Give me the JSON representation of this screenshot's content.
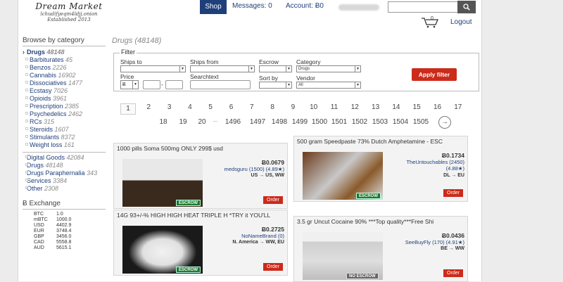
{
  "header": {
    "logo_name": "Dream Market",
    "logo_onion": "lchudifyeqm4ldjj.onion",
    "logo_established": "Established 2013",
    "shop_label": "Shop",
    "messages": "Messages: 0",
    "account": "Account: Ƀ0",
    "search_button": "search-icon",
    "cart_count": "0",
    "logout": "Logout"
  },
  "sidebar": {
    "title": "Browse by category",
    "categories": [
      {
        "label": "Drugs",
        "count": "48148"
      },
      {
        "label": "Barbiturates",
        "count": "45"
      },
      {
        "label": "Benzos",
        "count": "2226"
      },
      {
        "label": "Cannabis",
        "count": "16902"
      },
      {
        "label": "Dissociatives",
        "count": "1477"
      },
      {
        "label": "Ecstasy",
        "count": "7026"
      },
      {
        "label": "Opioids",
        "count": "3961"
      },
      {
        "label": "Prescription",
        "count": "2385"
      },
      {
        "label": "Psychedelics",
        "count": "2462"
      },
      {
        "label": "RCs",
        "count": "315"
      },
      {
        "label": "Steroids",
        "count": "1607"
      },
      {
        "label": "Stimulants",
        "count": "8372"
      },
      {
        "label": "Weight loss",
        "count": "161"
      }
    ],
    "top_categories": [
      {
        "label": "Digital Goods",
        "count": "42084"
      },
      {
        "label": "Drugs",
        "count": "48148"
      },
      {
        "label": "Drugs Paraphernalia",
        "count": "343"
      },
      {
        "label": "Services",
        "count": "3384"
      },
      {
        "label": "Other",
        "count": "2308"
      }
    ],
    "exchange_title": "Ƀ Exchange",
    "exchange": [
      {
        "cur": "BTC",
        "val": "1.0"
      },
      {
        "cur": "mBTC",
        "val": "1000.0"
      },
      {
        "cur": "USD",
        "val": "4402.9"
      },
      {
        "cur": "EUR",
        "val": "3748.4"
      },
      {
        "cur": "GBP",
        "val": "3456.0"
      },
      {
        "cur": "CAD",
        "val": "5558.8"
      },
      {
        "cur": "AUD",
        "val": "5615.1"
      }
    ]
  },
  "main": {
    "title": "Drugs (48148)",
    "filter": {
      "legend": "Filter",
      "ships_to": "Ships to",
      "ships_from": "Ships from",
      "escrow": "Escrow",
      "category": "Category",
      "category_value": "Drugs",
      "price": "Price",
      "price_currency": "Ƀ",
      "price_dash": "-",
      "searchtext": "Searchtext",
      "sort_by": "Sort by",
      "vendor": "Vendor",
      "vendor_value": "All",
      "apply": "Apply filter"
    },
    "pagination_row1": [
      "1",
      "2",
      "3",
      "4",
      "5",
      "6",
      "7",
      "8",
      "9",
      "10",
      "11",
      "12",
      "13",
      "14",
      "15",
      "16",
      "17"
    ],
    "pagination_row2": [
      "18",
      "19",
      "20",
      "...",
      "1496",
      "1497",
      "1498",
      "1499",
      "1500",
      "1501",
      "1502",
      "1503",
      "1504",
      "1505"
    ],
    "next_icon": "arrow-right-icon"
  },
  "listings": [
    {
      "title": "1000 pills Soma 500mg ONLY 299$ usd",
      "price": "Ƀ0.0679",
      "vendor": "medsguru (1500) (4.89★)",
      "ship": "US → US, WW",
      "escrow": "ESCROW",
      "order": "Order"
    },
    {
      "title": "500 gram Speedpaste 73% Dutch Amphetamine - ESC",
      "price": "Ƀ0.1734",
      "vendor": "TheUntouchables (2450)",
      "vendor_rating": "(4.88★)",
      "ship": "DL → EU",
      "escrow": "ESCROW",
      "order": "Order"
    },
    {
      "title": "14G 93+/-% HIGH HIGH HEAT TRIPLE H *TRY it YOU'LL",
      "price": "Ƀ0.2725",
      "vendor": "NoNameBrand (0)",
      "ship": "N. America → WW, EU",
      "escrow": "ESCROW",
      "order": "Order"
    },
    {
      "title": "3.5 gr Uncut Cocaine 90% ***Top quality***Free Shi",
      "price": "Ƀ0.0436",
      "vendor": "SeeBuyFly (170) (4.91★)",
      "ship": "BE → WW",
      "escrow": "NO ESCROW",
      "order": "Order"
    }
  ]
}
